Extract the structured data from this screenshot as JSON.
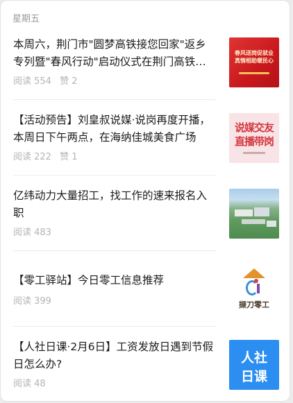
{
  "day_label": "星期五",
  "articles": [
    {
      "title": "本周六，荆门市\"圆梦高铁接您回家\"返乡专列暨\"春风行动\"启动仪式在荆门高铁站举行",
      "reads": "阅读 554",
      "likes": "赞 2",
      "thumb_icon": "red-poster-image",
      "thumb_text_1": "春风送岗促就业",
      "thumb_text_2": "真情相助暖民心"
    },
    {
      "title": "【活动预告】刘皇叔说媒·说岗再度开播，本周日下午两点，在海纳佳城美食广场",
      "reads": "阅读 222",
      "likes": "赞 1",
      "thumb_icon": "live-broadcast-image",
      "thumb_text_1": "说媒交友",
      "thumb_text_2": "直播带岗"
    },
    {
      "title": "亿纬动力大量招工，找工作的速来报名入职",
      "reads": "阅读 483",
      "thumb_icon": "aerial-photo-image"
    },
    {
      "title": "【零工驿站】今日零工信息推荐",
      "reads": "阅读 399",
      "thumb_icon": "odd-job-logo-image",
      "thumb_text_1": "撷刀零工"
    },
    {
      "title": "【人社日课·2月6日】工资发放日遇到节假日怎么办?",
      "reads": "阅读 48",
      "thumb_icon": "hrss-daily-lesson-image",
      "thumb_text_1": "人社",
      "thumb_text_2": "日课"
    }
  ],
  "colors": {
    "title": "#1a1a1a",
    "meta": "#b4b4b4",
    "day_label": "#9a9a9a",
    "divider": "#ececec",
    "accent_red": "#c9181c",
    "accent_blue": "#2b8ef0"
  }
}
